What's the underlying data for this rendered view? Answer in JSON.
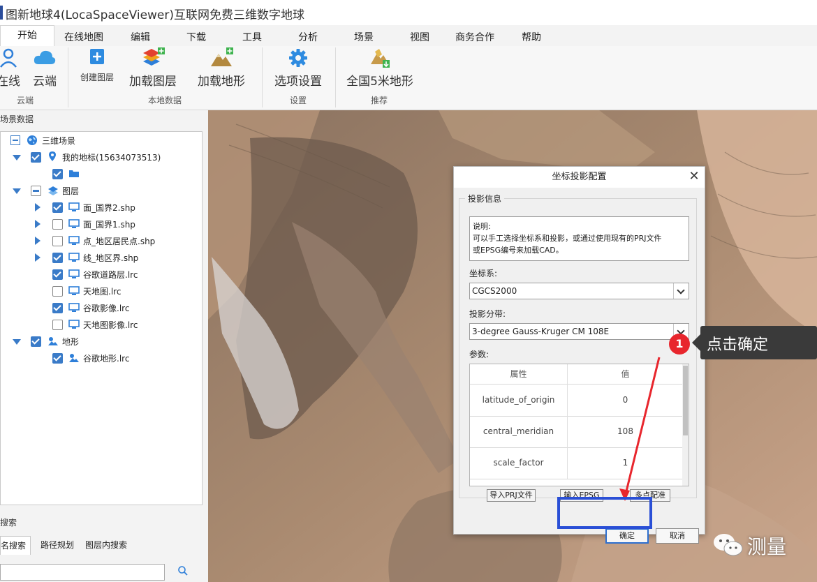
{
  "window": {
    "title": "图新地球4(LocaSpaceViewer)互联网免费三维数字地球"
  },
  "menu": {
    "items": [
      "开始",
      "在线地图",
      "编辑",
      "下载",
      "工具",
      "分析",
      "场景",
      "视图",
      "商务合作",
      "帮助"
    ]
  },
  "ribbon": {
    "buttons": {
      "online": "在线",
      "cloud": "云端",
      "create_layer": "创建图层",
      "load_layer": "加载图层",
      "load_terrain": "加载地形",
      "options": "选项设置",
      "terrain_5m": "全国5米地形"
    },
    "groups": {
      "cloud": "云端",
      "local_data": "本地数据",
      "settings": "设置",
      "recommend": "推荐"
    }
  },
  "left_panel": {
    "title": "场景数据",
    "tree": [
      {
        "label": "三维场景"
      },
      {
        "label": "我的地标(15634073513)"
      },
      {
        "label": ""
      },
      {
        "label": "图层"
      },
      {
        "label": "面_国界2.shp"
      },
      {
        "label": "面_国界1.shp"
      },
      {
        "label": "点_地区居民点.shp"
      },
      {
        "label": "线_地区界.shp"
      },
      {
        "label": "谷歌道路层.lrc"
      },
      {
        "label": "天地图.lrc"
      },
      {
        "label": "谷歌影像.lrc"
      },
      {
        "label": "天地图影像.lrc"
      },
      {
        "label": "地形"
      },
      {
        "label": "谷歌地形.lrc"
      }
    ],
    "search_title": "搜索",
    "search_tabs": [
      "名搜索",
      "路径规划",
      "图层内搜索"
    ],
    "search_placeholder": ""
  },
  "dialog": {
    "title": "坐标投影配置",
    "fieldset_legend": "投影信息",
    "description": "说明:\n可以手工选择坐标系和投影，或通过使用现有的PRJ文件\n或EPSG编号来加载CAD。",
    "crs_label": "坐标系:",
    "crs_value": "CGCS2000",
    "zone_label": "投影分带:",
    "zone_value": "3-degree Gauss-Kruger CM 108E",
    "params_label": "参数:",
    "params_header": [
      "属性",
      "值"
    ],
    "params": [
      {
        "name": "latitude_of_origin",
        "value": "0"
      },
      {
        "name": "central_meridian",
        "value": "108"
      },
      {
        "name": "scale_factor",
        "value": "1"
      }
    ],
    "import_prj": "导入PRJ文件",
    "input_epsg": "输入EPSG",
    "multi_point": "多点配准",
    "ok": "确定",
    "cancel": "取消"
  },
  "annotation": {
    "step": "1",
    "callout": "点击确定",
    "watermark": "测量",
    "highlight_color": "#2a4fd6",
    "badge_color": "#e8262d"
  }
}
